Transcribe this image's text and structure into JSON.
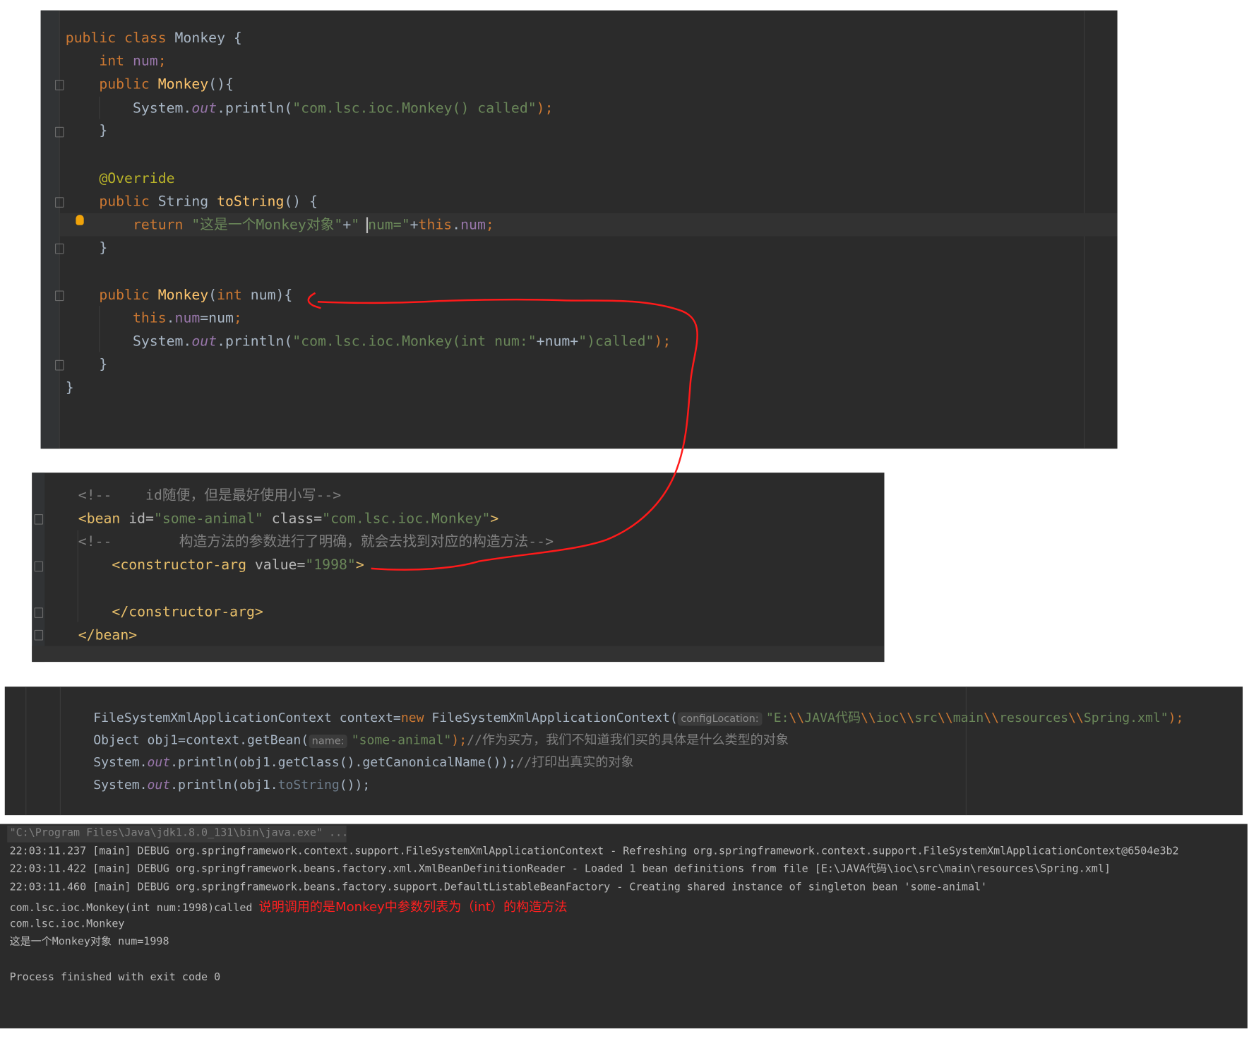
{
  "java_class_panel": {
    "lines": [
      [
        {
          "t": "public class ",
          "c": "k"
        },
        {
          "t": "Monkey {",
          "c": "p"
        }
      ],
      [
        {
          "t": "    int ",
          "c": "k"
        },
        {
          "t": "num",
          "c": "f"
        },
        {
          "t": ";",
          "c": "k"
        }
      ],
      [
        {
          "t": "    public ",
          "c": "k"
        },
        {
          "t": "Monkey",
          "c": "m"
        },
        {
          "t": "(){",
          "c": "p"
        }
      ],
      [
        {
          "t": "        System.",
          "c": "p"
        },
        {
          "t": "out",
          "c": "i"
        },
        {
          "t": ".println(",
          "c": "p"
        },
        {
          "t": "\"com.lsc.ioc.Monkey() called\"",
          "c": "s"
        },
        {
          "t": ");",
          "c": "k"
        }
      ],
      [
        {
          "t": "    }",
          "c": "p"
        }
      ],
      [],
      [
        {
          "t": "    @Override",
          "c": "a"
        }
      ],
      [
        {
          "t": "    public ",
          "c": "k"
        },
        {
          "t": "String ",
          "c": "p"
        },
        {
          "t": "toString",
          "c": "m"
        },
        {
          "t": "() {",
          "c": "p"
        }
      ],
      [
        {
          "t": "        return ",
          "c": "k"
        },
        {
          "t": "\"这是一个Monkey对象\"",
          "c": "s"
        },
        {
          "t": "+",
          "c": "p"
        },
        {
          "t": "\" num=\"",
          "c": "s"
        },
        {
          "t": "+",
          "c": "p"
        },
        {
          "t": "this",
          "c": "k"
        },
        {
          "t": ".",
          "c": "p"
        },
        {
          "t": "num",
          "c": "f"
        },
        {
          "t": ";",
          "c": "k"
        }
      ],
      [
        {
          "t": "    }",
          "c": "p"
        }
      ],
      [],
      [
        {
          "t": "    public ",
          "c": "k"
        },
        {
          "t": "Monkey",
          "c": "m"
        },
        {
          "t": "(",
          "c": "p"
        },
        {
          "t": "int ",
          "c": "k"
        },
        {
          "t": "num){",
          "c": "p"
        }
      ],
      [
        {
          "t": "        this",
          "c": "k"
        },
        {
          "t": ".",
          "c": "p"
        },
        {
          "t": "num",
          "c": "f"
        },
        {
          "t": "=num",
          "c": "p"
        },
        {
          "t": ";",
          "c": "k"
        }
      ],
      [
        {
          "t": "        System.",
          "c": "p"
        },
        {
          "t": "out",
          "c": "i"
        },
        {
          "t": ".println(",
          "c": "p"
        },
        {
          "t": "\"com.lsc.ioc.Monkey(int num:\"",
          "c": "s"
        },
        {
          "t": "+num+",
          "c": "p"
        },
        {
          "t": "\")called\"",
          "c": "s"
        },
        {
          "t": ");",
          "c": "k"
        }
      ],
      [
        {
          "t": "    }",
          "c": "p"
        }
      ],
      [
        {
          "t": "}",
          "c": "p"
        }
      ]
    ]
  },
  "xml_panel": {
    "lines": [
      [
        {
          "t": "<!--    id随便，但是最好使用小写-->",
          "c": "c"
        }
      ],
      [
        {
          "t": "<bean ",
          "c": "t"
        },
        {
          "t": "id=",
          "c": "at"
        },
        {
          "t": "\"some-animal\" ",
          "c": "s"
        },
        {
          "t": "class=",
          "c": "at"
        },
        {
          "t": "\"com.lsc.ioc.Monkey\"",
          "c": "s"
        },
        {
          "t": ">",
          "c": "t"
        }
      ],
      [
        {
          "t": "<!--        构造方法的参数进行了明确，就会去找到对应的构造方法-->",
          "c": "c"
        }
      ],
      [
        {
          "t": "    <constructor-arg ",
          "c": "t"
        },
        {
          "t": "value=",
          "c": "at"
        },
        {
          "t": "\"1998\"",
          "c": "s"
        },
        {
          "t": ">",
          "c": "t"
        }
      ],
      [],
      [
        {
          "t": "    </constructor-arg>",
          "c": "t"
        }
      ],
      [
        {
          "t": "</bean>",
          "c": "t"
        }
      ]
    ]
  },
  "main_panel": {
    "lines": [
      [
        {
          "t": "FileSystemXmlApplicationContext context=",
          "c": "p"
        },
        {
          "t": "new ",
          "c": "k"
        },
        {
          "t": "FileSystemXmlApplicationContext(",
          "c": "p"
        },
        {
          "t": "configLocation:",
          "c": "h"
        },
        {
          "t": "\"E:",
          "c": "s"
        },
        {
          "t": "\\\\",
          "c": "k"
        },
        {
          "t": "JAVA代码",
          "c": "s"
        },
        {
          "t": "\\\\",
          "c": "k"
        },
        {
          "t": "ioc",
          "c": "s"
        },
        {
          "t": "\\\\",
          "c": "k"
        },
        {
          "t": "src",
          "c": "s"
        },
        {
          "t": "\\\\",
          "c": "k"
        },
        {
          "t": "main",
          "c": "s"
        },
        {
          "t": "\\\\",
          "c": "k"
        },
        {
          "t": "resources",
          "c": "s"
        },
        {
          "t": "\\\\",
          "c": "k"
        },
        {
          "t": "Spring.xml\"",
          "c": "s"
        },
        {
          "t": ");",
          "c": "k"
        }
      ],
      [
        {
          "t": "Object obj1=context.getBean(",
          "c": "p"
        },
        {
          "t": "name:",
          "c": "h"
        },
        {
          "t": "\"some-animal\"",
          "c": "s"
        },
        {
          "t": ");",
          "c": "k"
        },
        {
          "t": "//作为买方，我们不知道我们买的具体是什么类型的对象",
          "c": "c"
        }
      ],
      [
        {
          "t": "System.",
          "c": "p"
        },
        {
          "t": "out",
          "c": "i"
        },
        {
          "t": ".println(obj1.getClass().getCanonicalName());",
          "c": "p"
        },
        {
          "t": "//打印出真实的对象",
          "c": "c"
        }
      ],
      [
        {
          "t": "System.",
          "c": "p"
        },
        {
          "t": "out",
          "c": "i"
        },
        {
          "t": ".println(obj1.",
          "c": "p"
        },
        {
          "t": "toString",
          "c": "d"
        },
        {
          "t": "());",
          "c": "p"
        }
      ]
    ]
  },
  "console": {
    "lines": [
      [
        {
          "t": "\"C:\\Program Files\\Java\\jdk1.8.0_131\\bin\\java.exe\" ...",
          "c": "c"
        }
      ],
      [
        {
          "t": "22:03:11.237 [main] DEBUG org.springframework.context.support.FileSystemXmlApplicationContext - Refreshing org.springframework.context.support.FileSystemXmlApplicationContext@6504e3b2",
          "c": ""
        }
      ],
      [
        {
          "t": "22:03:11.422 [main] DEBUG org.springframework.beans.factory.xml.XmlBeanDefinitionReader - Loaded 1 bean definitions from file [E:\\JAVA代码\\ioc\\src\\main\\resources\\Spring.xml]",
          "c": ""
        }
      ],
      [
        {
          "t": "22:03:11.460 [main] DEBUG org.springframework.beans.factory.support.DefaultListableBeanFactory - Creating shared instance of singleton bean 'some-animal'",
          "c": ""
        }
      ],
      [
        {
          "t": "com.lsc.ioc.Monkey(int num:1998)called ",
          "c": ""
        },
        {
          "t": "说明调用的是Monkey中参数列表为（int）的构造方法",
          "c": "r"
        }
      ],
      [
        {
          "t": "com.lsc.ioc.Monkey",
          "c": ""
        }
      ],
      [
        {
          "t": "这是一个Monkey对象 num=1998",
          "c": ""
        }
      ],
      [],
      [
        {
          "t": "Process finished with exit code 0",
          "c": ""
        }
      ]
    ]
  },
  "colors": {
    "editor_bg": "#2b2b2b",
    "annotation_red": "#ff2020"
  }
}
